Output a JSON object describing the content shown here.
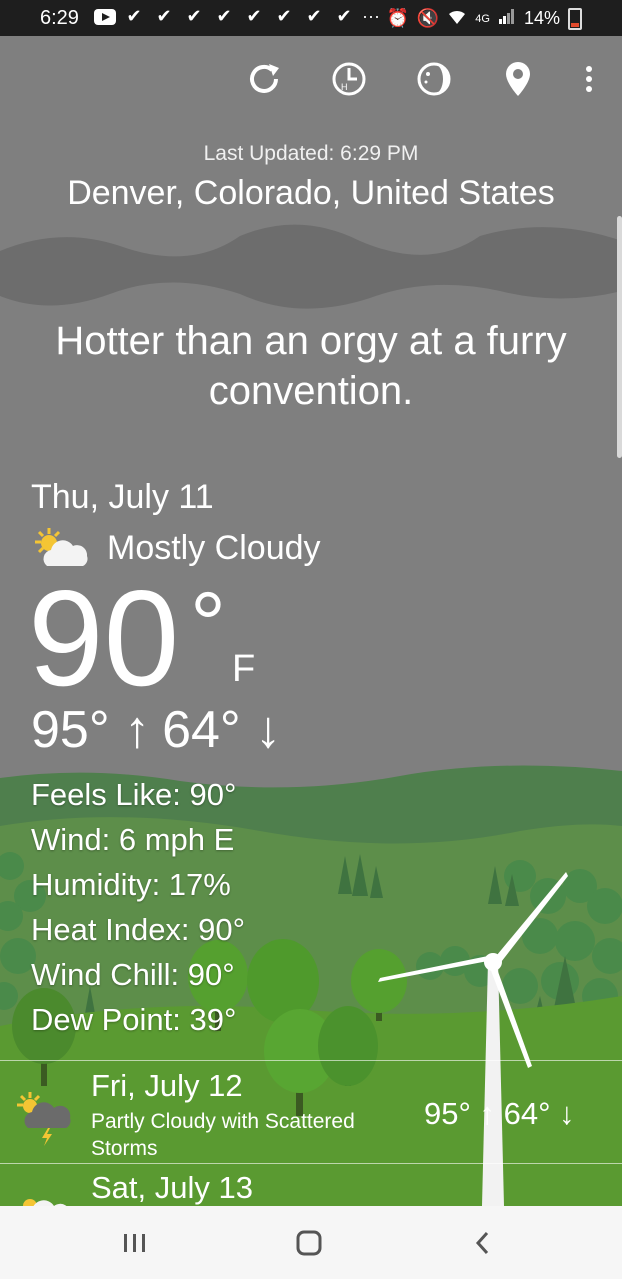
{
  "status_bar": {
    "time": "6:29",
    "battery": "14%",
    "network": "4G",
    "icons": [
      "youtube-icon",
      "check-icon",
      "check-icon",
      "check-icon",
      "check-icon",
      "check-icon",
      "check-icon",
      "check-icon",
      "check-icon",
      "more-dots-icon",
      "alarm-icon",
      "mute-icon",
      "wifi-icon",
      "signal-icon",
      "battery-icon"
    ]
  },
  "toolbar": {
    "buttons": [
      "refresh-icon",
      "hourly-clock-icon",
      "moon-icon",
      "location-pin-icon",
      "overflow-menu-icon"
    ]
  },
  "header": {
    "last_updated": "Last Updated: 6:29 PM",
    "location": "Denver, Colorado, United States"
  },
  "quip": "Hotter than an orgy at a furry convention.",
  "current": {
    "date": "Thu, July 11",
    "condition": "Mostly Cloudy",
    "condition_icon": "mostly-cloudy-icon",
    "temperature": "90",
    "degree": "°",
    "unit": "F",
    "high": "95° ↑",
    "low": "64° ↓",
    "details": {
      "feels_like": "Feels Like: 90°",
      "wind": "Wind: 6 mph E",
      "humidity": "Humidity: 17%",
      "heat_index": "Heat Index: 90°",
      "wind_chill": "Wind Chill: 90°",
      "dew_point": "Dew Point: 39°"
    }
  },
  "forecast": [
    {
      "date": "Fri, July 12",
      "description": "Partly Cloudy with Scattered Storms",
      "temps": "95° ↑ 64° ↓",
      "icon": "partly-cloudy-storms-icon"
    },
    {
      "date": "Sat, July 13",
      "description": "",
      "temps": "",
      "icon": "partly-cloudy-icon"
    }
  ],
  "nav_bar": {
    "buttons": [
      "recent-apps-icon",
      "home-icon",
      "back-icon"
    ]
  },
  "colors": {
    "sky": "#7f7f7f",
    "cloud": "#6c6c6c",
    "grass": "#5a9a31",
    "status_bar": "#1e1e1e",
    "nav_bar": "#f6f6f6"
  }
}
